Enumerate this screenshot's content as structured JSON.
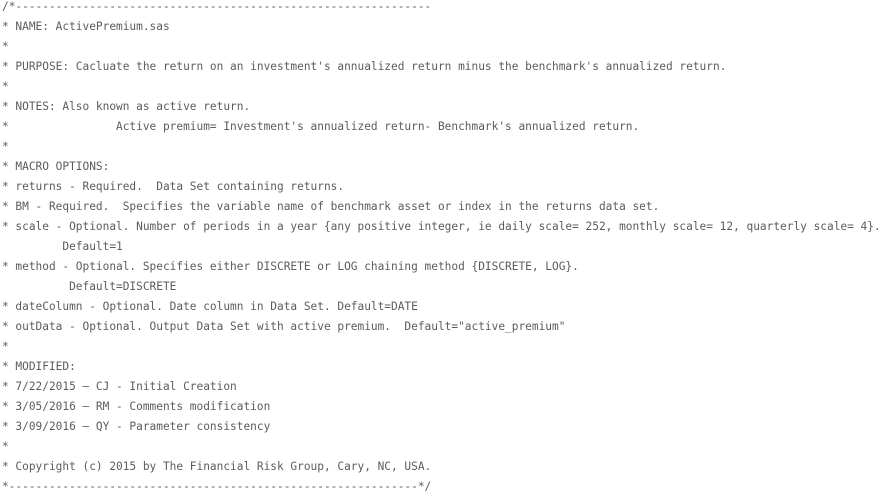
{
  "file": {
    "name": "ActivePremium.sas",
    "lines": [
      "/*--------------------------------------------------------------",
      "* NAME: ActivePremium.sas",
      "*",
      "* PURPOSE: Cacluate the return on an investment's annualized return minus the benchmark's annualized return.",
      "*",
      "* NOTES: Also known as active return.",
      "*                Active premium= Investment's annualized return- Benchmark's annualized return.",
      "*",
      "* MACRO OPTIONS:",
      "* returns - Required.  Data Set containing returns.",
      "* BM - Required.  Specifies the variable name of benchmark asset or index in the returns data set.",
      "* scale - Optional. Number of periods in a year {any positive integer, ie daily scale= 252, monthly scale= 12, quarterly scale= 4}.",
      "         Default=1",
      "* method - Optional. Specifies either DISCRETE or LOG chaining method {DISCRETE, LOG}.",
      "          Default=DISCRETE",
      "* dateColumn - Optional. Date column in Data Set. Default=DATE",
      "* outData - Optional. Output Data Set with active premium.  Default=\"active_premium\"",
      "*",
      "* MODIFIED:",
      "* 7/22/2015 – CJ - Initial Creation",
      "* 3/05/2016 – RM - Comments modification",
      "* 3/09/2016 – QY - Parameter consistency",
      "*",
      "* Copyright (c) 2015 by The Financial Risk Group, Cary, NC, USA.",
      "*-------------------------------------------------------------*/"
    ]
  }
}
